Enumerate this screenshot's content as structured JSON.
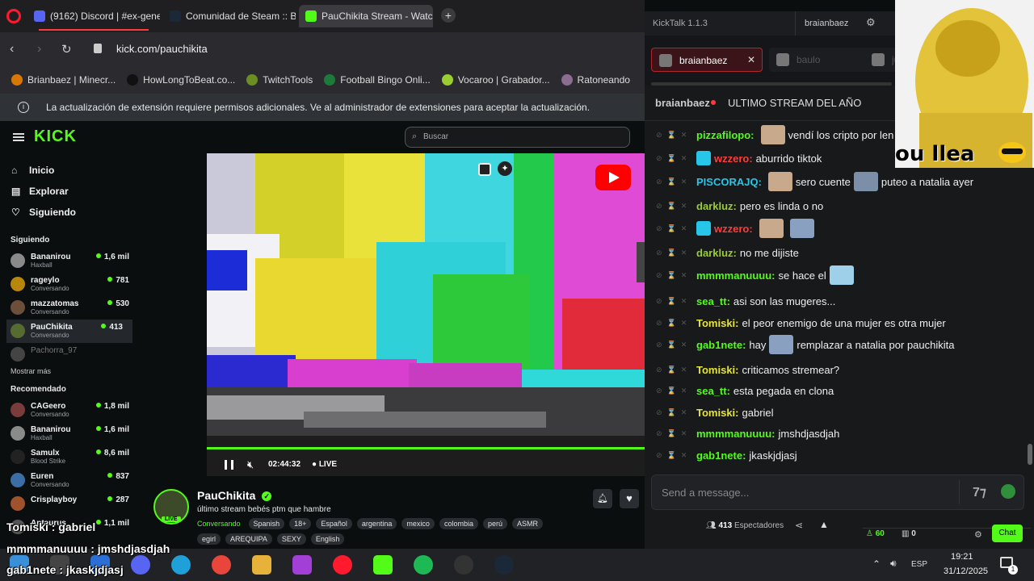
{
  "browser": {
    "tabs": [
      {
        "label": "(9162) Discord | #ex-gene",
        "color": "#5865f2",
        "active": false
      },
      {
        "label": "Comunidad de Steam :: Br",
        "color": "#1b2838",
        "active": false
      },
      {
        "label": "PauChikita Stream - Watc",
        "color": "#53fc18",
        "active": true
      }
    ],
    "url": "kick.com/pauchikita",
    "bookmarks": [
      {
        "label": "Brianbaez | Minecr...",
        "color": "#d97706"
      },
      {
        "label": "HowLongToBeat.co...",
        "color": "#111111"
      },
      {
        "label": "TwitchTools",
        "color": "#6b8e23"
      },
      {
        "label": "Football Bingo Onli...",
        "color": "#1e7a3a"
      },
      {
        "label": "Vocaroo | Grabador...",
        "color": "#9acd32"
      },
      {
        "label": "Ratoneando",
        "color": "#8a6d8f"
      }
    ],
    "infobar_text": "La actualización de extensión requiere permisos adicionales. Ve al administrador de extensiones para aceptar la actualización."
  },
  "kick": {
    "logo": "KICK",
    "search_placeholder": "Buscar",
    "nav": [
      {
        "label": "Inicio",
        "icon": "home-icon"
      },
      {
        "label": "Explorar",
        "icon": "browse-icon"
      },
      {
        "label": "Siguiendo",
        "icon": "heart-icon"
      }
    ],
    "following_title": "Siguiendo",
    "following": [
      {
        "name": "Bananirou",
        "sub": "Haxball",
        "viewers": "1,6 mil",
        "color": "#8a8a8a"
      },
      {
        "name": "rageylo",
        "sub": "Conversando",
        "viewers": "781",
        "color": "#b8860b"
      },
      {
        "name": "mazzatomas",
        "sub": "Conversando",
        "viewers": "530",
        "color": "#6b4f3a"
      },
      {
        "name": "PauChikita",
        "sub": "Conversando",
        "viewers": "413",
        "color": "#556b2f"
      }
    ],
    "offline_channel": "Pachorra_97",
    "show_more": "Mostrar más",
    "recommended_title": "Recomendado",
    "recommended": [
      {
        "name": "CAGeero",
        "sub": "Conversando",
        "viewers": "1,8 mil",
        "color": "#7a3b3b"
      },
      {
        "name": "Bananirou",
        "sub": "Haxball",
        "viewers": "1,6 mil",
        "color": "#8a8a8a"
      },
      {
        "name": "Samulx",
        "sub": "Blood Strike",
        "viewers": "8,6 mil",
        "color": "#222222"
      },
      {
        "name": "Euren",
        "sub": "Conversando",
        "viewers": "837",
        "color": "#3a6ea5"
      },
      {
        "name": "Crisplayboy",
        "sub": "",
        "viewers": "287",
        "color": "#a0522d"
      },
      {
        "name": "Antaurus",
        "sub": "",
        "viewers": "1,1 mil",
        "color": "#555555"
      }
    ],
    "player": {
      "time": "02:44:32",
      "live": "LIVE",
      "progress": 1.0
    },
    "stream": {
      "channel": "PauChikita",
      "title": "último stream bebés ptm que hambre",
      "category": "Conversando",
      "live_badge": "LIVE",
      "tags": [
        "Spanish",
        "18+",
        "Español",
        "argentina",
        "mexico",
        "colombia",
        "perú",
        "ASMR",
        "egirl",
        "AREQUIPA",
        "SEXY",
        "English"
      ]
    }
  },
  "kicktalk": {
    "app_title": "KickTalk 1.1.3",
    "user": "braianbaez",
    "tabs": [
      {
        "label": "braianbaez",
        "active": true
      },
      {
        "label": "baulo",
        "active": false
      },
      {
        "label": "ju",
        "active": false
      }
    ],
    "stream_header_user": "braianbaez",
    "stream_header_title": "ULTIMO STREAM DEL AÑO",
    "messages": [
      {
        "user": "pizzafilopo:",
        "color": "#53fc18",
        "emotes_before": 1,
        "text": "vendí los cripto por len",
        "badge": false
      },
      {
        "user": "wzzero:",
        "color": "#ff3b3b",
        "emotes_before": 0,
        "text": "aburrido tiktok",
        "badge": true
      },
      {
        "user": "PISCORAJQ:",
        "color": "#27c6e8",
        "emotes_before": 1,
        "text": "sero cuente",
        "after_emote": true,
        "text2": "puteo a natalia ayer",
        "badge": false
      },
      {
        "user": "darkluz:",
        "color": "#9acd32",
        "emotes_before": 0,
        "text": "pero es linda o no",
        "badge": false
      },
      {
        "user": "wzzero:",
        "color": "#ff3b3b",
        "emotes_before": 2,
        "text": "",
        "badge": true
      },
      {
        "user": "darkluz:",
        "color": "#9acd32",
        "emotes_before": 0,
        "text": "no me dijiste",
        "badge": false
      },
      {
        "user": "mmmmanuuuu:",
        "color": "#53fc18",
        "emotes_before": 0,
        "text": "se hace el",
        "emote_after": true,
        "badge": false
      },
      {
        "user": "sea_tt:",
        "color": "#53fc18",
        "emotes_before": 0,
        "text": "asi son las mugeres...",
        "badge": false
      },
      {
        "user": "Tomiski:",
        "color": "#e6e63a",
        "emotes_before": 0,
        "text": "el peor enemigo de una mujer es otra mujer",
        "badge": false
      },
      {
        "user": "gab1nete:",
        "color": "#53fc18",
        "emotes_before": 0,
        "text": "hay",
        "emote_mid": true,
        "text2": "remplazar a natalia por pauchikita",
        "badge": false
      },
      {
        "user": "Tomiski:",
        "color": "#e6e63a",
        "emotes_before": 0,
        "text": "criticamos stremear?",
        "badge": false
      },
      {
        "user": "sea_tt:",
        "color": "#53fc18",
        "emotes_before": 0,
        "text": "esta pegada en clona",
        "badge": false
      },
      {
        "user": "Tomiski:",
        "color": "#e6e63a",
        "emotes_before": 0,
        "text": "gabriel",
        "badge": false
      },
      {
        "user": "mmmmanuuuu:",
        "color": "#53fc18",
        "emotes_before": 0,
        "text": "jmshdjasdjah",
        "badge": false
      },
      {
        "user": "gab1nete:",
        "color": "#53fc18",
        "emotes_before": 0,
        "text": "jkaskjdjasj",
        "badge": false
      }
    ],
    "input_placeholder": "Send a message...",
    "viewers": "413",
    "viewers_label": "Espectadores",
    "stat1": "60",
    "stat2": "0",
    "chat_button": "Chat"
  },
  "webcam_caption": "ou llea",
  "overlay_lines": [
    "Tomiski : gabriel",
    "mmmmanuuuu : jmshdjasdjah",
    "gab1nete : jkaskjdjasj"
  ],
  "taskbar": {
    "lang": "ESP",
    "time": "19:21",
    "date": "31/12/2025",
    "notif_count": "1"
  },
  "colors": {
    "kick_green": "#53fc18",
    "chat_bg": "#18191b",
    "page_bg": "#0b0e0f"
  }
}
